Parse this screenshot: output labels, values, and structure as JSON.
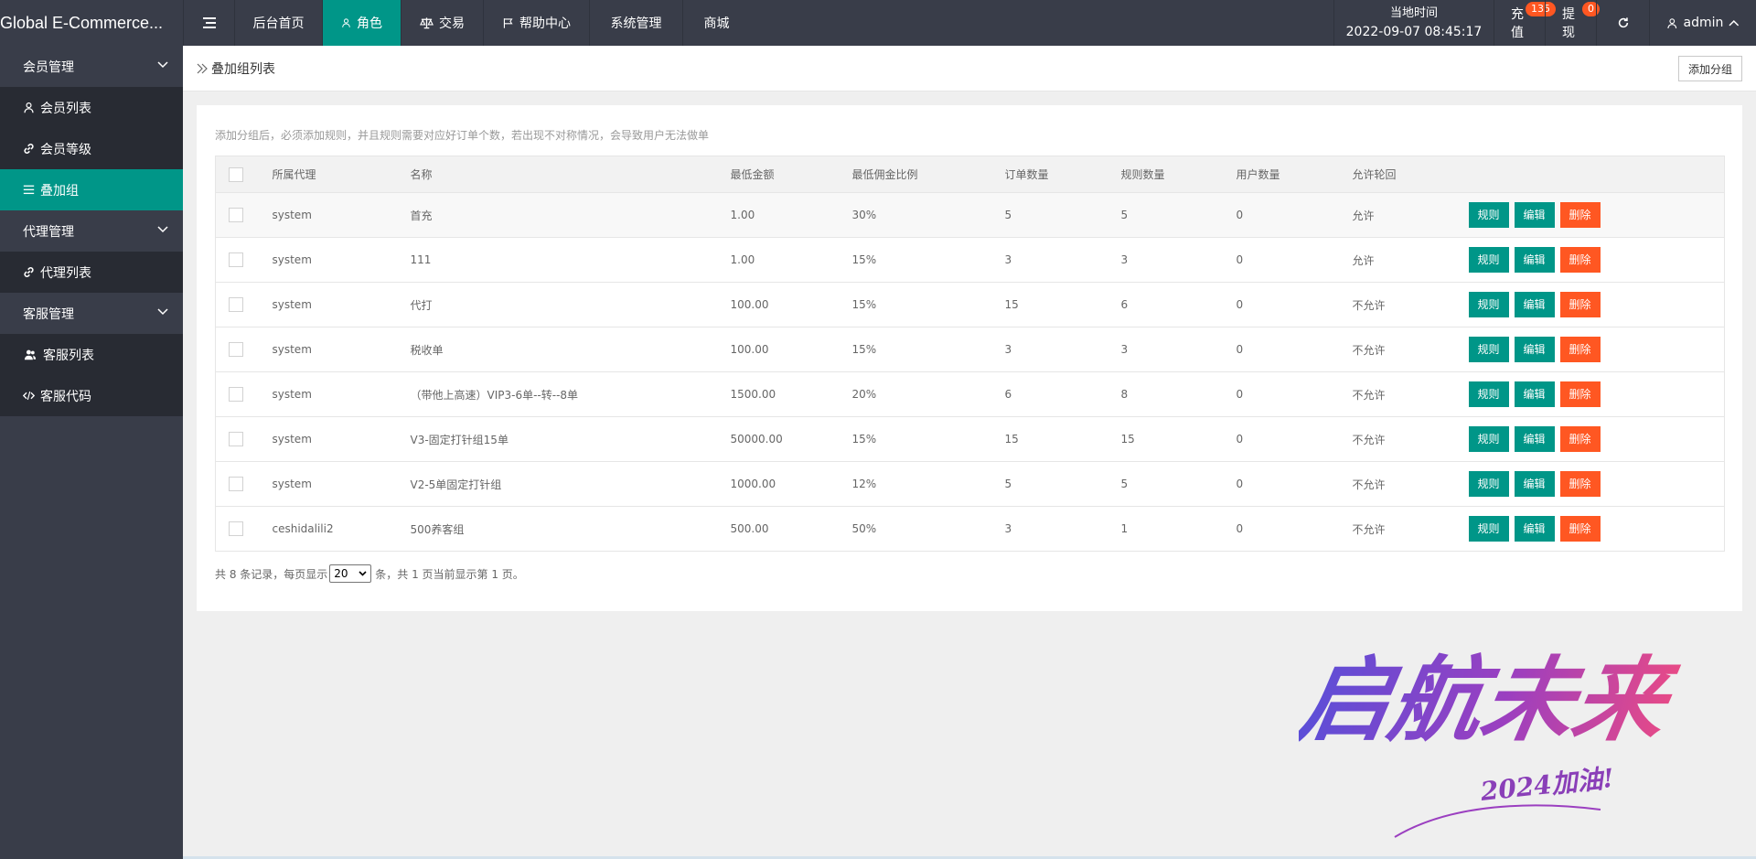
{
  "app": {
    "title": "Global E-Commerce..."
  },
  "topnav": {
    "menu_icon": "menu-icon",
    "items": [
      {
        "label": "后台首页"
      },
      {
        "label": "角色",
        "icon": "user-icon",
        "active": true
      },
      {
        "label": "交易",
        "icon": "scale-icon"
      },
      {
        "label": "帮助中心",
        "icon": "flag-icon"
      },
      {
        "label": "系统管理"
      },
      {
        "label": "商城"
      }
    ],
    "clock": {
      "label": "当地时间",
      "value": "2022-09-07 08:45:17"
    },
    "recharge": {
      "label": "充值",
      "badge": "135"
    },
    "withdraw": {
      "label": "提现",
      "badge": "0"
    },
    "refresh_icon": "refresh-icon",
    "user": {
      "label": "admin"
    }
  },
  "sidebar": {
    "groups": [
      {
        "label": "会员管理",
        "items": [
          {
            "label": "会员列表",
            "icon": "user-icon"
          },
          {
            "label": "会员等级",
            "icon": "link-icon"
          },
          {
            "label": "叠加组",
            "icon": "list-icon",
            "active": true
          }
        ]
      },
      {
        "label": "代理管理",
        "items": [
          {
            "label": "代理列表",
            "icon": "link-icon"
          }
        ]
      },
      {
        "label": "客服管理",
        "items": [
          {
            "label": "客服列表",
            "icon": "users-icon"
          },
          {
            "label": "客服代码",
            "icon": "code-icon"
          }
        ]
      }
    ]
  },
  "page": {
    "breadcrumb": "叠加组列表",
    "add_button": "添加分组",
    "tip": "添加分组后，必须添加规则，并且规则需要对应好订单个数，若出现不对称情况，会导致用户无法做单"
  },
  "table": {
    "headers": [
      "所属代理",
      "名称",
      "最低金额",
      "最低佣金比例",
      "订单数量",
      "规则数量",
      "用户数量",
      "允许轮回"
    ],
    "actions": {
      "rule": "规则",
      "edit": "编辑",
      "delete": "删除"
    },
    "rows": [
      [
        "system",
        "首充",
        "1.00",
        "30%",
        "5",
        "5",
        "0",
        "允许"
      ],
      [
        "system",
        "111",
        "1.00",
        "15%",
        "3",
        "3",
        "0",
        "允许"
      ],
      [
        "system",
        "代打",
        "100.00",
        "15%",
        "15",
        "6",
        "0",
        "不允许"
      ],
      [
        "system",
        "税收单",
        "100.00",
        "15%",
        "3",
        "3",
        "0",
        "不允许"
      ],
      [
        "system",
        "（带他上高速）VIP3-6单--转--8单",
        "1500.00",
        "20%",
        "6",
        "8",
        "0",
        "不允许"
      ],
      [
        "system",
        "V3-固定打针组15单",
        "50000.00",
        "15%",
        "15",
        "15",
        "0",
        "不允许"
      ],
      [
        "system",
        "V2-5单固定打针组",
        "1000.00",
        "12%",
        "5",
        "5",
        "0",
        "不允许"
      ],
      [
        "ceshidalili2",
        "500养客组",
        "500.00",
        "50%",
        "3",
        "1",
        "0",
        "不允许"
      ]
    ]
  },
  "pager": {
    "prefix": "共 8 条记录，每页显示",
    "page_size": "20",
    "suffix": "条，共 1 页当前显示第 1 页。"
  },
  "watermark": {
    "text": "启航未来",
    "sub": "2024加油!"
  },
  "colors": {
    "topbar": "#393d49",
    "accent": "#009688",
    "danger": "#ff5722",
    "sidebar_item": "#282b33"
  }
}
